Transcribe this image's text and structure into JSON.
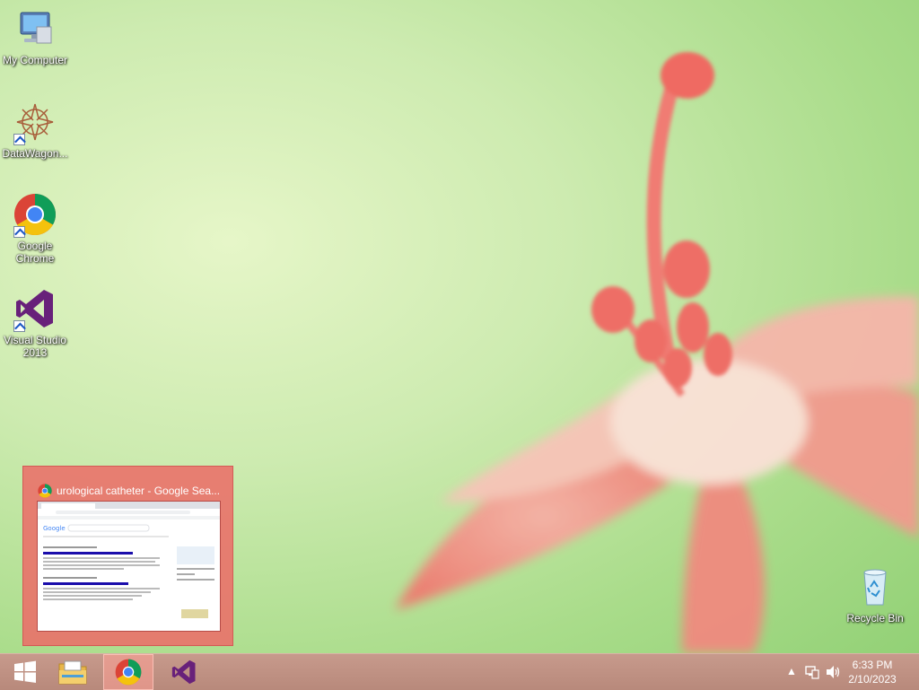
{
  "desktop": {
    "icons": [
      {
        "label": "My Computer"
      },
      {
        "label": "DataWagon..."
      },
      {
        "label": "Google Chrome"
      },
      {
        "label": "Visual Studio 2013"
      },
      {
        "label": "Recycle Bin"
      }
    ]
  },
  "preview": {
    "title": "urological catheter - Google Sea...",
    "icon": "chrome-icon"
  },
  "taskbar": {
    "buttons": [
      {
        "name": "start",
        "icon": "windows-logo-icon"
      },
      {
        "name": "file-explorer",
        "icon": "folder-icon"
      },
      {
        "name": "chrome",
        "icon": "chrome-icon",
        "active": true
      },
      {
        "name": "visual-studio",
        "icon": "visual-studio-icon"
      }
    ],
    "tray": {
      "icons": [
        "show-hidden-icons-icon",
        "network-icon",
        "volume-icon"
      ]
    },
    "clock": {
      "time": "6:33 PM",
      "date": "2/10/2023"
    }
  },
  "colors": {
    "taskbar": "#b8897b",
    "preview_bg": "#eb6e69",
    "chrome_red": "#db4437",
    "chrome_yellow": "#f4c20d",
    "chrome_green": "#0f9d58",
    "chrome_blue": "#4285f4",
    "vs_purple": "#68217a"
  }
}
